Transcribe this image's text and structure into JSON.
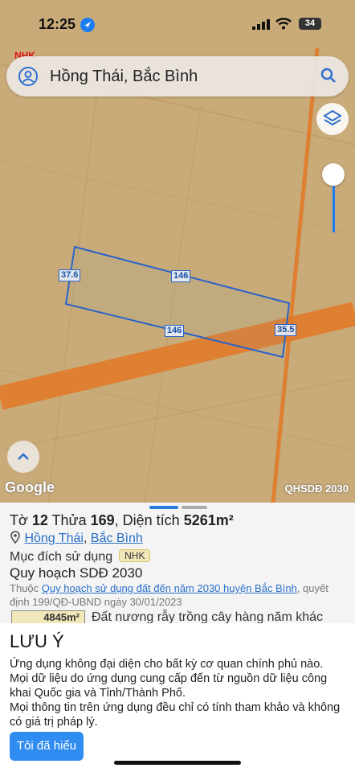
{
  "status_bar": {
    "time": "12:25",
    "battery": "34"
  },
  "map": {
    "overlay_label": "NHK",
    "search_text": "Hồng Thái, Bắc Bình",
    "edge_labels": {
      "top": "146",
      "bottom": "146",
      "left": "37.6",
      "right": "35.5"
    },
    "attribution": "Google",
    "layer_name": "QHSDĐ 2030"
  },
  "sheet": {
    "title_prefix": "Tờ ",
    "sheet_no": "12",
    "title_mid1": " Thửa ",
    "parcel_no": "169",
    "title_mid2": ", Diện tích ",
    "area": "5261m²",
    "commune": "Hồng Thái",
    "comma": ",",
    "district": "Bắc Bình",
    "purpose_label": "Mục đích sử dụng",
    "purpose_code": "NHK",
    "plan_label": "Quy hoạch SDĐ 2030",
    "belong_prefix": "Thuộc",
    "belong_link": "Quy hoạch sử dụng đất đến năm 2030 huyện Bắc Bình",
    "belong_suffix": ", quyết định 199/QĐ-UBND ngày 30/01/2023",
    "partial_area": "4845m²",
    "partial_text": "Đất nương rẫy trồng cây hàng năm khác"
  },
  "notice": {
    "title": "LƯU Ý",
    "line1": "Ứng dụng không đại diện cho bất kỳ cơ quan chính phủ nào.",
    "line2": "Mọi dữ liệu do ứng dụng cung cấp đến từ nguồn dữ liệu công khai Quốc gia và Tỉnh/Thành Phố.",
    "line3": "Mọi thông tin trên ứng dụng đều chỉ có tính tham khảo và không có giá trị pháp lý.",
    "button": "Tôi đã hiểu"
  }
}
